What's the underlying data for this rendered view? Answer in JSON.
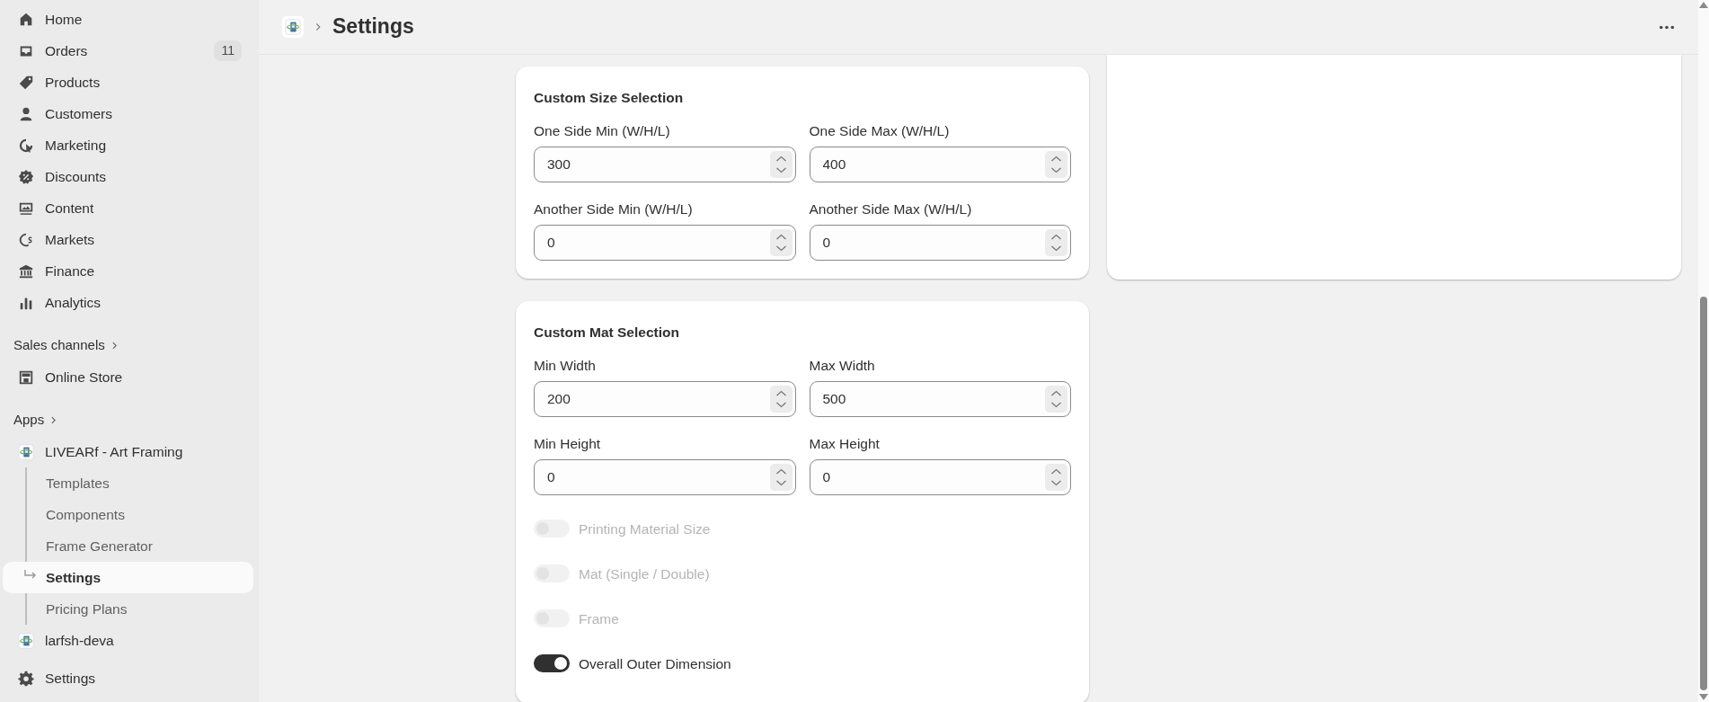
{
  "sidebar": {
    "nav_items": [
      {
        "label": "Home",
        "selected": false
      },
      {
        "label": "Orders",
        "badge": "11",
        "selected": false
      },
      {
        "label": "Products",
        "selected": false
      },
      {
        "label": "Customers",
        "selected": false
      },
      {
        "label": "Marketing",
        "selected": false
      },
      {
        "label": "Discounts",
        "selected": false
      },
      {
        "label": "Content",
        "selected": false
      },
      {
        "label": "Markets",
        "selected": false
      },
      {
        "label": "Finance",
        "selected": false
      },
      {
        "label": "Analytics",
        "selected": false
      }
    ],
    "sales_channels": {
      "heading": "Sales channels",
      "items": [
        {
          "label": "Online Store",
          "selected": false
        }
      ]
    },
    "apps": {
      "heading": "Apps",
      "items": [
        {
          "label": "LIVEARf - Art Framing",
          "children": [
            {
              "label": "Templates",
              "selected": false
            },
            {
              "label": "Components",
              "selected": false
            },
            {
              "label": "Frame Generator",
              "selected": false
            },
            {
              "label": "Settings",
              "selected": true
            },
            {
              "label": "Pricing Plans",
              "selected": false
            }
          ]
        },
        {
          "label": "larfsh-deva"
        }
      ]
    },
    "footer_item": {
      "label": "Settings",
      "selected": false
    }
  },
  "header": {
    "title": "Settings"
  },
  "cards": [
    {
      "title": "Custom Size Selection",
      "fields": [
        {
          "label": "One Side Min (W/H/L)",
          "value": "300"
        },
        {
          "label": "One Side Max (W/H/L)",
          "value": "400"
        },
        {
          "label": "Another Side Min (W/H/L)",
          "value": "0"
        },
        {
          "label": "Another Side Max (W/H/L)",
          "value": "0"
        }
      ]
    },
    {
      "title": "Custom Mat Selection",
      "fields": [
        {
          "label": "Min Width",
          "value": "200"
        },
        {
          "label": "Max Width",
          "value": "500"
        },
        {
          "label": "Min Height",
          "value": "0"
        },
        {
          "label": "Max Height",
          "value": "0"
        }
      ],
      "toggles": [
        {
          "label": "Printing Material Size",
          "on": false,
          "disabled": true
        },
        {
          "label": "Mat (Single / Double)",
          "on": false,
          "disabled": true
        },
        {
          "label": "Frame",
          "on": false,
          "disabled": true
        },
        {
          "label": "Overall Outer Dimension",
          "on": true,
          "disabled": false
        }
      ]
    }
  ]
}
